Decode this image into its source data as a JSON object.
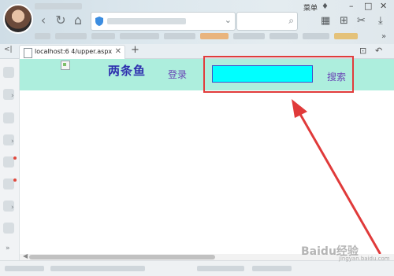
{
  "browser": {
    "menu_label": "菜单",
    "tab_title": "localhost:6   4/upper.aspx",
    "new_tab_label": "+",
    "nav": {
      "back": "‹",
      "forward": "›",
      "refresh": "↻",
      "home": "⌂"
    },
    "window_controls": {
      "minimize": "–",
      "maximize": "□",
      "close": "✕"
    }
  },
  "page": {
    "site_title": "两条鱼",
    "login_label": "登录",
    "search_value": "",
    "search_button_label": "搜索",
    "header_color": "#adeedd",
    "input_color": "#00ffff"
  },
  "annotation": {
    "highlight_color": "#e13c3c"
  },
  "watermark": {
    "logo_text": "Baidu经验",
    "sub_text": "jingyan.baidu.com"
  }
}
